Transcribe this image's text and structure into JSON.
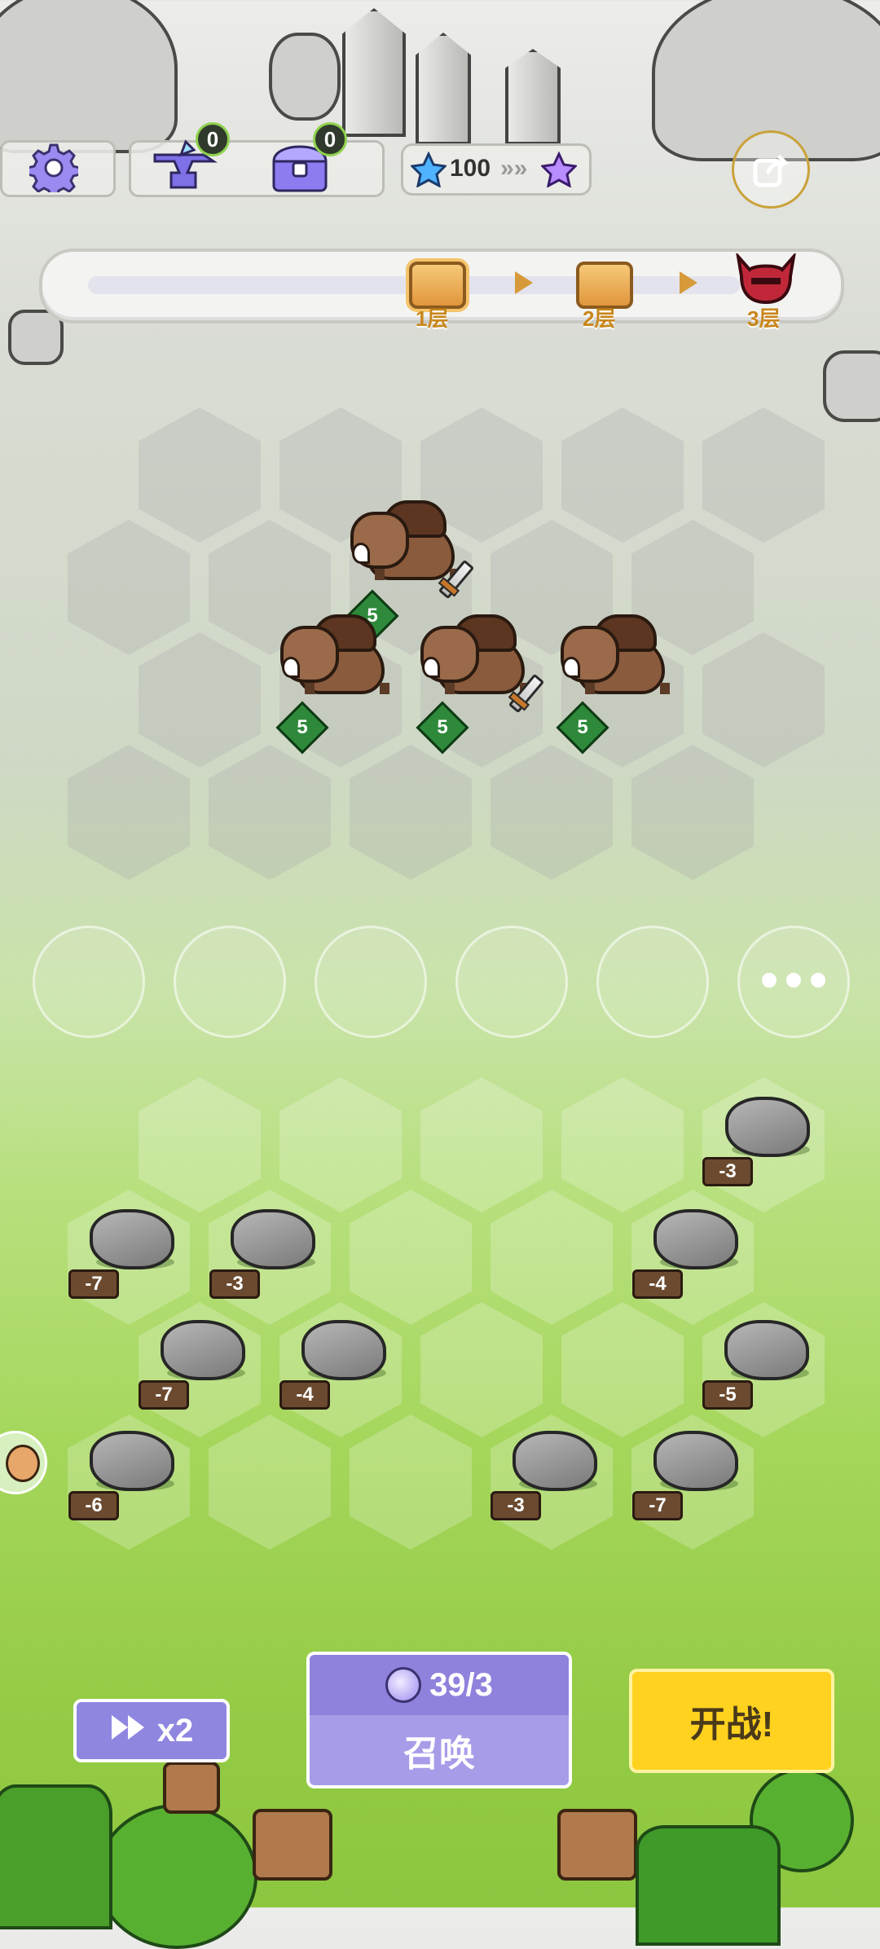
{
  "topbar": {
    "anvil_count": "0",
    "chest_count": "0",
    "stars_value": "100"
  },
  "progress": {
    "floors": [
      "1层",
      "2层",
      "3层"
    ]
  },
  "enemies": {
    "levels": [
      "5",
      "5",
      "5",
      "5"
    ]
  },
  "obstacles": [
    "-3",
    "-7",
    "-3",
    "-4",
    "-7",
    "-4",
    "-5",
    "-6",
    "-3",
    "-7"
  ],
  "controls": {
    "speed_label": "x2",
    "summon_cost": "39/3",
    "summon_label": "召唤",
    "fight_label": "开战!"
  },
  "colors": {
    "accent_purple": "#8f86e0",
    "fight_yellow": "#ffd21f",
    "level_green": "#2e8a3a"
  }
}
